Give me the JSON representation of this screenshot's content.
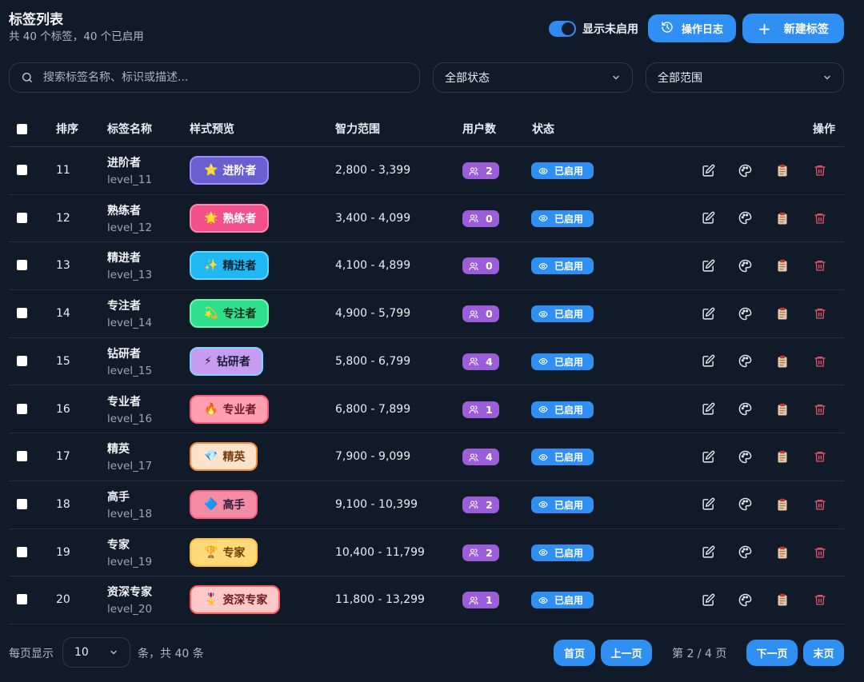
{
  "header": {
    "title": "标签列表",
    "subtitle": "共 40 个标签，40 个已启用",
    "toggle_label": "显示未启用",
    "toggle_on": true,
    "log_button": "操作日志",
    "new_button": "新建标签"
  },
  "filters": {
    "search_placeholder": "搜索标签名称、标识或描述...",
    "status_selected": "全部状态",
    "range_selected": "全部范围"
  },
  "table": {
    "columns": {
      "order": "排序",
      "name": "标签名称",
      "preview": "样式预览",
      "range": "智力范围",
      "users": "用户数",
      "status": "状态",
      "actions": "操作"
    },
    "rows": [
      {
        "order": "11",
        "name": "进阶者",
        "key": "level_11",
        "tag_icon": "star-icon",
        "emoji": "⭐",
        "tag": "进阶者",
        "range": "2,800 - 3,399",
        "users": "2",
        "status": "已启用",
        "bg": "#6a5fd0",
        "border": "#9c8cff",
        "text": "#ffffff"
      },
      {
        "order": "12",
        "name": "熟练者",
        "key": "level_12",
        "tag_icon": "sparkle-star-icon",
        "emoji": "🌟",
        "tag": "熟练者",
        "range": "3,400 - 4,099",
        "users": "0",
        "status": "已启用",
        "bg": "#f2508a",
        "border": "#ff86b0",
        "text": "#ffffff"
      },
      {
        "order": "13",
        "name": "精进者",
        "key": "level_13",
        "tag_icon": "sparkles-icon",
        "emoji": "✨",
        "tag": "精进者",
        "range": "4,100 - 4,899",
        "users": "0",
        "status": "已启用",
        "bg": "#1fb8f2",
        "border": "#5ed6ff",
        "text": "#0d2233"
      },
      {
        "order": "14",
        "name": "专注者",
        "key": "level_14",
        "tag_icon": "dizzy-icon",
        "emoji": "💫",
        "tag": "专注者",
        "range": "4,900 - 5,799",
        "users": "0",
        "status": "已启用",
        "bg": "#2ee08c",
        "border": "#6df5b4",
        "text": "#0d2a1e"
      },
      {
        "order": "15",
        "name": "钻研者",
        "key": "level_15",
        "tag_icon": "lightning-icon",
        "emoji": "⚡",
        "tag": "钻研者",
        "range": "5,800 - 6,799",
        "users": "4",
        "status": "已启用",
        "bg": "#c89cf0",
        "border": "#7bd3ff",
        "text": "#1b1b33"
      },
      {
        "order": "16",
        "name": "专业者",
        "key": "level_16",
        "tag_icon": "fire-icon",
        "emoji": "🔥",
        "tag": "专业者",
        "range": "6,800 - 7,899",
        "users": "1",
        "status": "已启用",
        "bg": "#ff9fb0",
        "border": "#ff5c7a",
        "text": "#6a1b2b"
      },
      {
        "order": "17",
        "name": "精英",
        "key": "level_17",
        "tag_icon": "gem-icon",
        "emoji": "💎",
        "tag": "精英",
        "range": "7,900 - 9,099",
        "users": "4",
        "status": "已启用",
        "bg": "#fde3cc",
        "border": "#f08a3a",
        "text": "#7a3a10"
      },
      {
        "order": "18",
        "name": "高手",
        "key": "level_18",
        "tag_icon": "diamond-icon",
        "emoji": "🔷",
        "tag": "高手",
        "range": "9,100 - 10,399",
        "users": "2",
        "status": "已启用",
        "bg": "#f48ca6",
        "border": "#ff5c86",
        "text": "#2b1b3a"
      },
      {
        "order": "19",
        "name": "专家",
        "key": "level_19",
        "tag_icon": "trophy-icon",
        "emoji": "🏆",
        "tag": "专家",
        "range": "10,400 - 11,799",
        "users": "2",
        "status": "已启用",
        "bg": "#ffd97a",
        "border": "#ffc23a",
        "text": "#6a4200"
      },
      {
        "order": "20",
        "name": "资深专家",
        "key": "level_20",
        "tag_icon": "medal-icon",
        "emoji": "🎖️",
        "tag": "资深专家",
        "range": "11,800 - 13,299",
        "users": "1",
        "status": "已启用",
        "bg": "#ffc9c9",
        "border": "#ff5c5c",
        "text": "#6a1b1b"
      }
    ]
  },
  "footer": {
    "per_page_label": "每页显示",
    "per_page_value": "10",
    "total_label": "条，共 40 条",
    "first": "首页",
    "prev": "上一页",
    "page_indicator": "第 2 / 4 页",
    "next": "下一页",
    "last": "末页"
  },
  "colors": {
    "background": "#111a28",
    "accent": "#2f8ff2",
    "users_badge": "#9b5ed8",
    "delete": "#e0566b"
  }
}
